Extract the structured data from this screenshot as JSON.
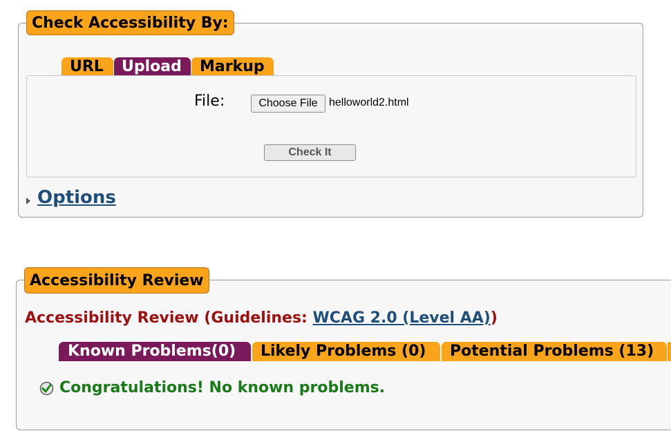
{
  "check_section": {
    "legend": "Check Accessibility By:",
    "tabs": [
      {
        "label": "URL",
        "active": false
      },
      {
        "label": "Upload",
        "active": true
      },
      {
        "label": "Markup",
        "active": false
      }
    ],
    "file_label": "File:",
    "choose_file_label": "Choose File",
    "file_name": "helloworld2.html",
    "check_button_label": "Check It",
    "options_link": "Options"
  },
  "review_section": {
    "legend": "Accessibility Review",
    "heading_prefix": "Accessibility Review (Guidelines: ",
    "guideline_link": "WCAG 2.0 (Level AA)",
    "heading_suffix": ")",
    "tabs": [
      {
        "label": "Known Problems(0)",
        "active": true
      },
      {
        "label": "Likely Problems (0)",
        "active": false
      },
      {
        "label": "Potential Problems (13)",
        "active": false
      }
    ],
    "message": "Congratulations! No known problems."
  },
  "colors": {
    "tab_orange": "#f9a41a",
    "tab_active": "#7b1a5a",
    "heading_red": "#9b1010",
    "success_green": "#1a7a1a",
    "link_blue": "#1f4e79"
  },
  "icons": {
    "options_toggle": "triangle-right-icon",
    "success": "checkmark-icon"
  }
}
